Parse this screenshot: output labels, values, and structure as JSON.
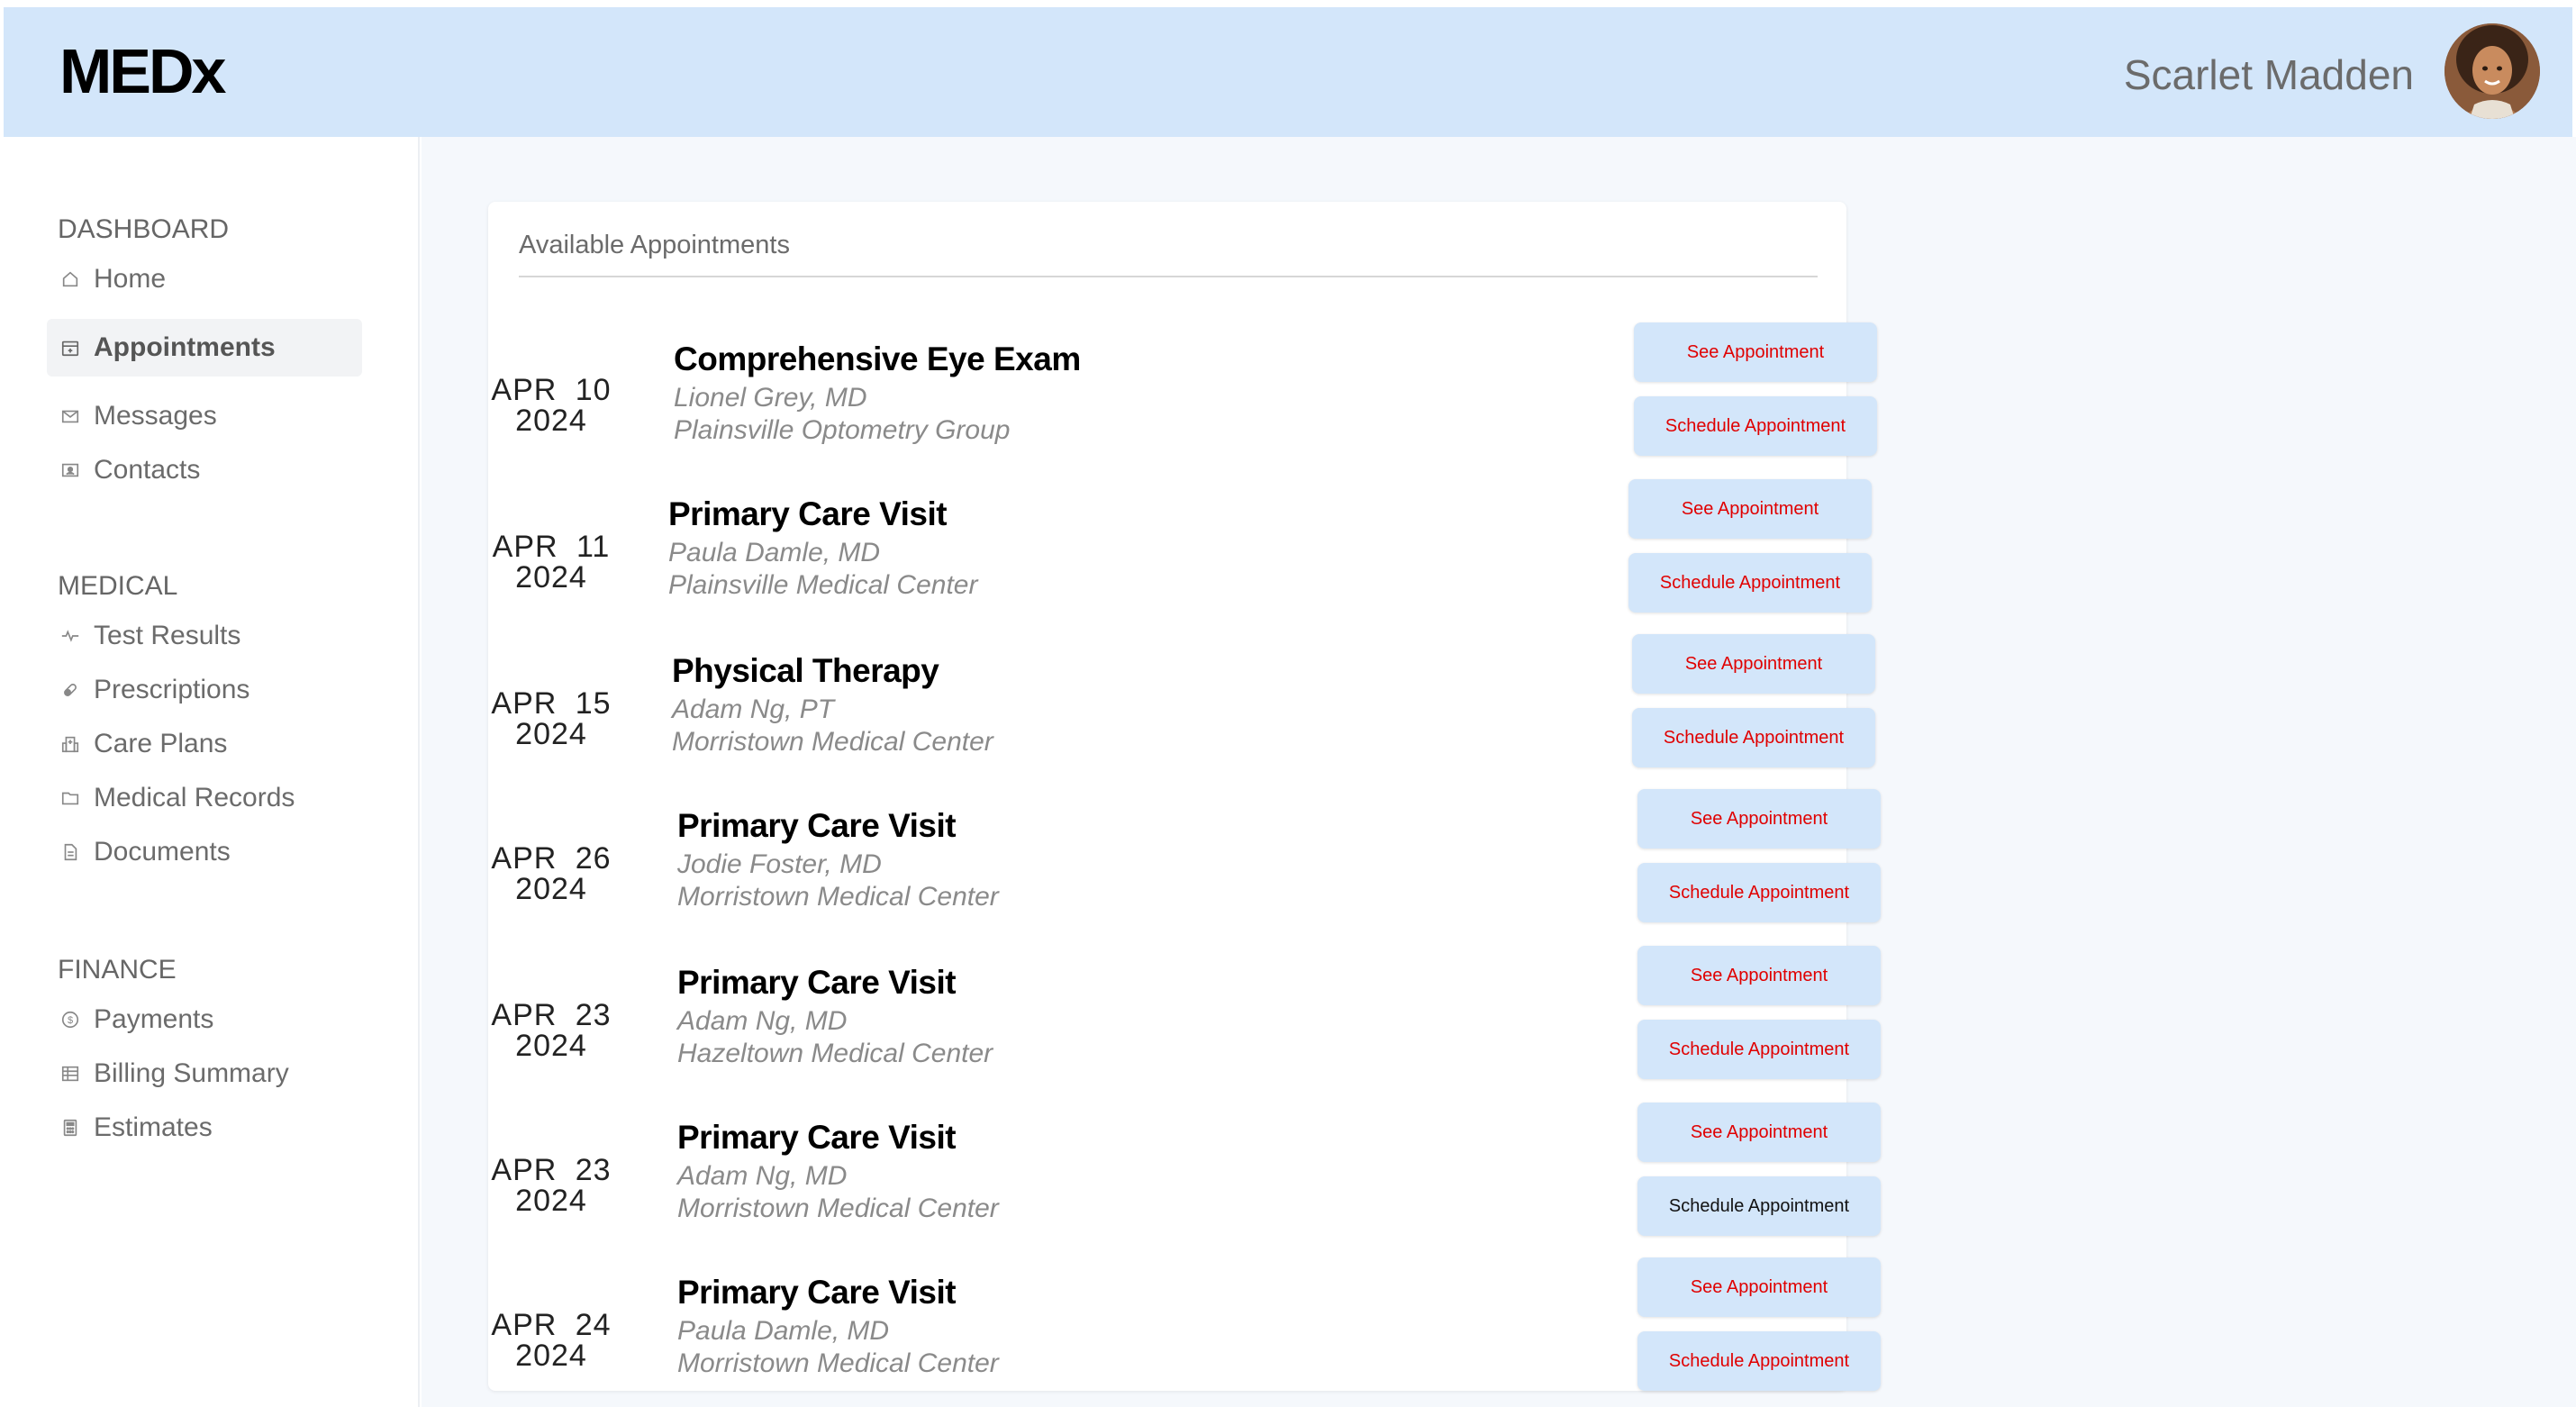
{
  "header": {
    "logo": "MEDx",
    "user_name": "Scarlet Madden"
  },
  "sidebar": {
    "sections": [
      {
        "label": "DASHBOARD",
        "items": [
          {
            "label": "Home",
            "icon": "home-icon"
          },
          {
            "label": "Appointments",
            "icon": "calendar-icon",
            "active": true
          },
          {
            "label": "Messages",
            "icon": "envelope-icon"
          },
          {
            "label": "Contacts",
            "icon": "contact-card-icon"
          }
        ]
      },
      {
        "label": "MEDICAL",
        "items": [
          {
            "label": "Test Results",
            "icon": "pulse-icon"
          },
          {
            "label": "Prescriptions",
            "icon": "pill-icon"
          },
          {
            "label": "Care Plans",
            "icon": "hospital-icon"
          },
          {
            "label": "Medical Records",
            "icon": "folder-icon"
          },
          {
            "label": "Documents",
            "icon": "document-icon"
          }
        ]
      },
      {
        "label": "FINANCE",
        "items": [
          {
            "label": "Payments",
            "icon": "dollar-coin-icon"
          },
          {
            "label": "Billing Summary",
            "icon": "ledger-icon"
          },
          {
            "label": "Estimates",
            "icon": "calculator-icon"
          }
        ]
      }
    ]
  },
  "main": {
    "card_title": "Available Appointments",
    "see_label": "See Appointment",
    "schedule_label": "Schedule Appointment",
    "appointments": [
      {
        "date": "APR 10 2024",
        "title": "Comprehensive Eye Exam",
        "doctor": "Lionel Grey, MD",
        "location": "Plainsville Optometry Group"
      },
      {
        "date": "APR 11 2024",
        "title": "Primary Care Visit",
        "doctor": "Paula Damle, MD",
        "location": "Plainsville Medical Center"
      },
      {
        "date": "APR 15 2024",
        "title": "Physical Therapy",
        "doctor": "Adam Ng, PT",
        "location": "Morristown Medical Center"
      },
      {
        "date": "APR 26 2024",
        "title": "Primary Care Visit",
        "doctor": "Jodie Foster, MD",
        "location": "Morristown Medical Center"
      },
      {
        "date": "APR 23 2024",
        "title": "Primary Care Visit",
        "doctor": "Adam Ng, MD",
        "location": "Hazeltown Medical Center"
      },
      {
        "date": "APR 23 2024",
        "title": "Primary Care Visit",
        "doctor": "Adam Ng, MD",
        "location": "Morristown Medical Center"
      },
      {
        "date": "APR 24 2024",
        "title": "Primary Care Visit",
        "doctor": "Paula Damle, MD",
        "location": "Morristown Medical Center"
      }
    ]
  },
  "colors": {
    "header_bg": "#d3e6fa",
    "button_bg": "#d3e6fa",
    "button_text": "#e00000",
    "main_bg": "#f5f8fc"
  }
}
